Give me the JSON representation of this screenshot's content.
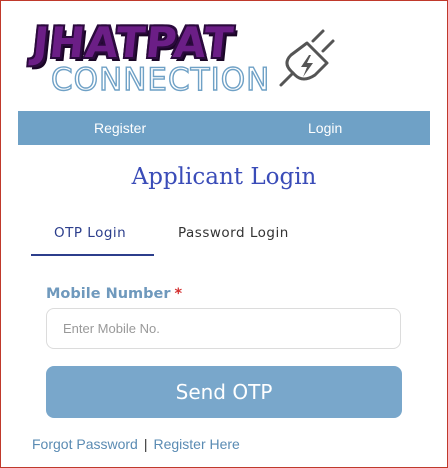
{
  "logo": {
    "title": "JHATPAT",
    "subtitle": "CONNECTION",
    "icon": "electric-plug-icon"
  },
  "nav": {
    "register_label": "Register",
    "login_label": "Login"
  },
  "page": {
    "title": "Applicant Login"
  },
  "tabs": [
    {
      "label": "OTP Login",
      "active": true
    },
    {
      "label": "Password Login",
      "active": false
    }
  ],
  "form": {
    "mobile_label": "Mobile Number",
    "required_marker": "*",
    "mobile_placeholder": "Enter Mobile No.",
    "mobile_value": "",
    "submit_label": "Send OTP"
  },
  "footer_links": {
    "forgot_password": "Forgot Password",
    "separator": "|",
    "register_here": "Register Here"
  },
  "colors": {
    "nav_background": "#6fa1c6",
    "button_background": "#79a7cb",
    "title_color": "#3a4cb8",
    "active_tab_color": "#2c3e8c",
    "label_color": "#6f99bd",
    "required_color": "#d32f2f",
    "link_color": "#5a8bb3",
    "logo_purple": "#6b1e86"
  }
}
